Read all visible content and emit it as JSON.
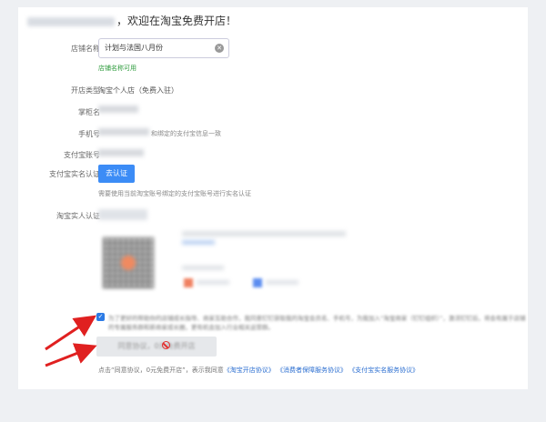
{
  "page": {
    "title": "，欢迎在淘宝免费开店！"
  },
  "form": {
    "shop_name_label": "店铺名称",
    "shop_name_value": "计划与法国八月份",
    "shop_name_ok": "店铺名称可用",
    "shop_type_label": "开店类型",
    "shop_type_value": "淘宝个人店（免费入驻）",
    "owner_label": "掌柜名",
    "phone_label": "手机号",
    "phone_note": "和绑定的支付宝信息一致",
    "alipay_label": "支付宝账号",
    "alipay_verify_label": "支付宝实名认证",
    "alipay_verify_button": "去认证",
    "alipay_verify_hint": "需要使用当前淘宝账号绑定的支付宝账号进行实名认证",
    "taobao_verify_label": "淘宝实人认证"
  },
  "agreement": {
    "checkbox_text": "为了更好的帮助你的店铺成长指导、商家互助合作，我同意钉钉获取我的淘宝会员名、手机号，为我加入“淘宝商家（钉钉组织）”，激活钉钉后，将会有属于店铺的专属服务群和新商家成长圈，更有机会加入行业相关运营群。",
    "button_label": "同意协议，0元免费开店",
    "footer_prefix": "点击“同意协议，0元免费开店”，表示我同意",
    "link1": "《淘宝开店协议》",
    "link2": "《消费者保障服务协议》",
    "link3": "《支付宝实名服务协议》"
  },
  "icons": {
    "clear": "clear-circle-icon",
    "prohibited": "prohibited-cursor-icon",
    "checkbox": "checkmark-icon",
    "arrows": "red-arrow-icon"
  },
  "colors": {
    "accent": "#3c8cf6",
    "success": "#2e9b3c",
    "arrow": "#e02020"
  }
}
